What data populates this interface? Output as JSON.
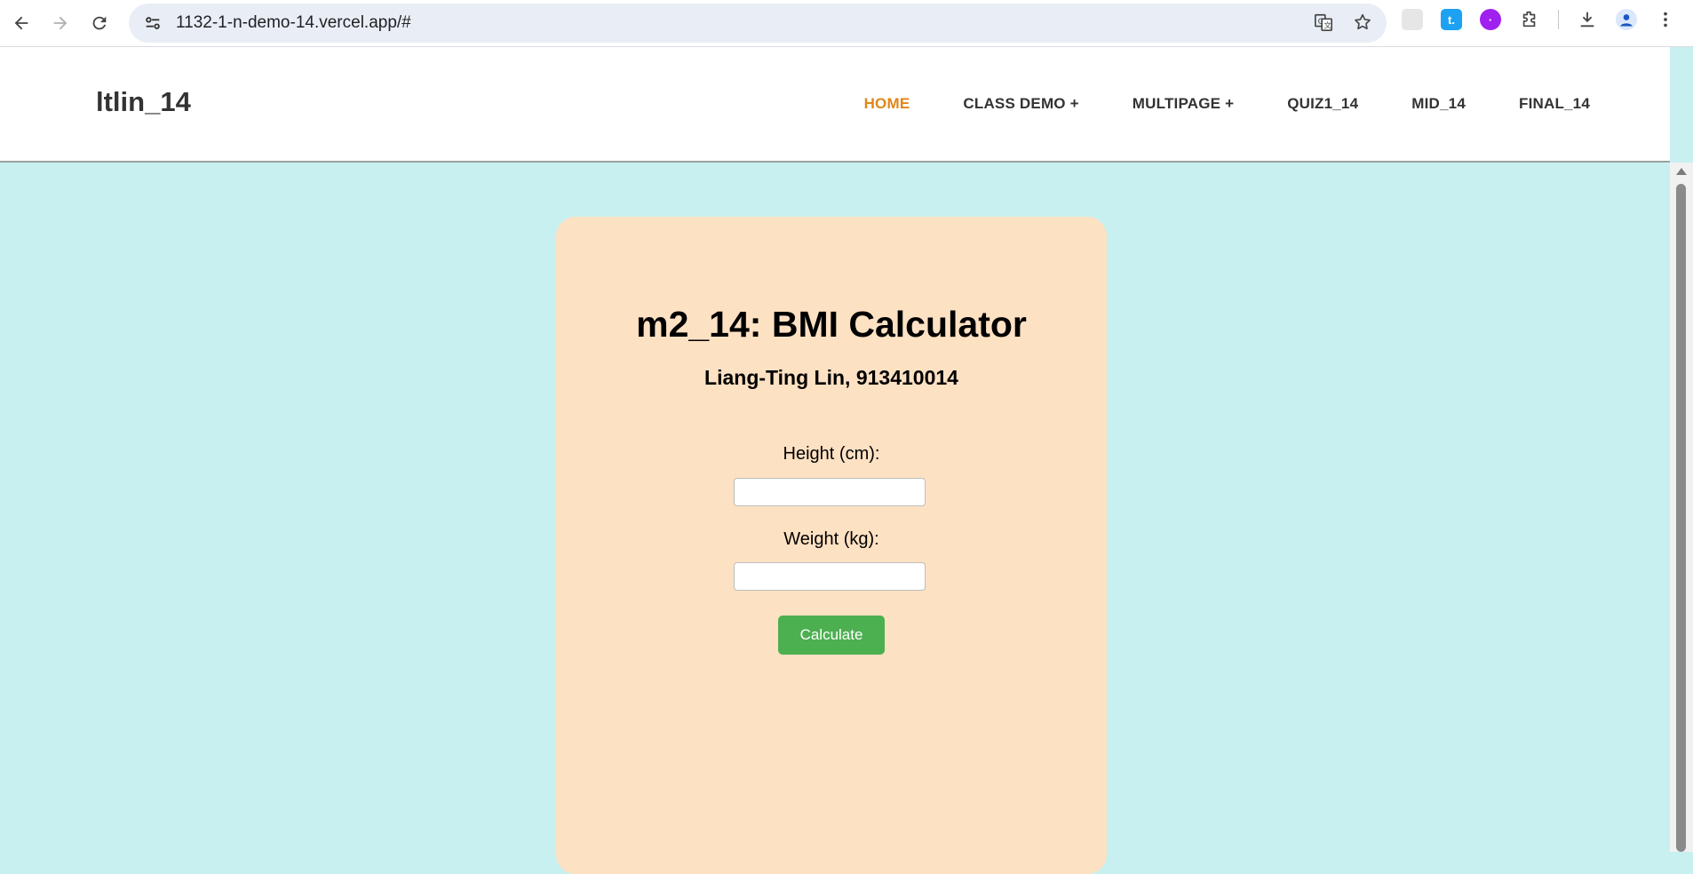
{
  "browser": {
    "url": "1132-1-n-demo-14.vercel.app/#"
  },
  "site": {
    "brand": "ltlin_14",
    "menu": [
      {
        "label": "HOME",
        "active": true
      },
      {
        "label": "CLASS DEMO +",
        "active": false
      },
      {
        "label": "MULTIPAGE +",
        "active": false
      },
      {
        "label": "QUIZ1_14",
        "active": false
      },
      {
        "label": "MID_14",
        "active": false
      },
      {
        "label": "FINAL_14",
        "active": false
      }
    ]
  },
  "calculator": {
    "title": "m2_14: BMI Calculator",
    "subtitle": "Liang-Ting Lin, 913410014",
    "height_label": "Height (cm):",
    "height_value": "",
    "weight_label": "Weight (kg):",
    "weight_value": "",
    "button_label": "Calculate"
  },
  "colors": {
    "page_bg": "#c8f0f0",
    "card_bg": "#fde1c3",
    "active_menu": "#e0861a",
    "button_bg": "#4caf50"
  }
}
